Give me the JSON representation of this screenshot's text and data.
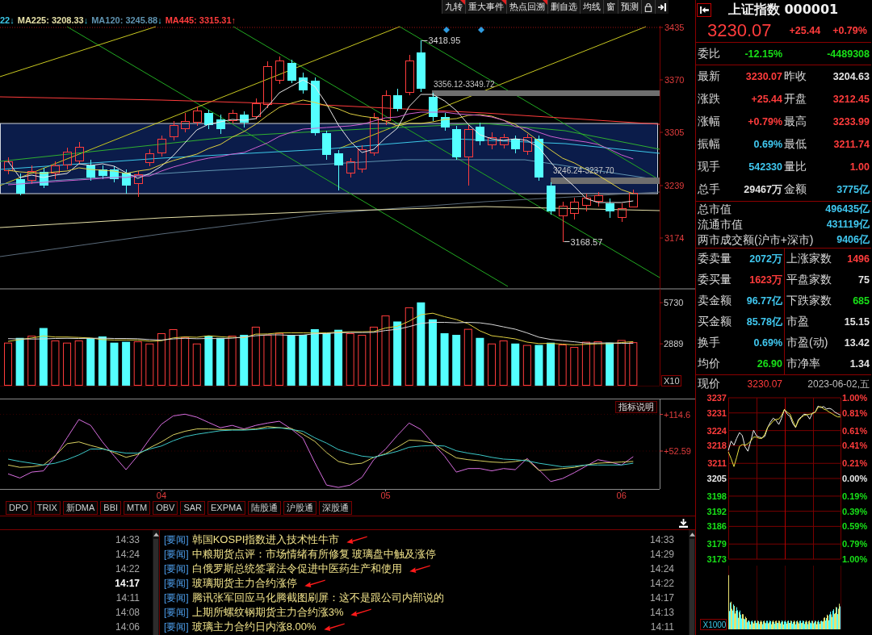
{
  "toolbar": {
    "buttons": [
      {
        "label": "九转",
        "flagged": true
      },
      {
        "label": "重大事件",
        "flagged": true
      },
      {
        "label": "热点回溯",
        "flagged": true
      },
      {
        "label": "删自选",
        "flagged": false
      },
      {
        "label": "均线",
        "flagged": false
      },
      {
        "label": "窗",
        "flagged": false
      },
      {
        "label": "预测",
        "flagged": false
      }
    ]
  },
  "ma_legend": [
    {
      "label": "22",
      "arrow": "↓",
      "rising": false,
      "color": "#3cc8e8"
    },
    {
      "label": "MA225: 3208.33",
      "arrow": "↓",
      "rising": false,
      "color": "#e6e0a8"
    },
    {
      "label": "MA120: 3245.88",
      "arrow": "↓",
      "rising": false,
      "color": "#5f93b0"
    },
    {
      "label": "MA445: 3315.31",
      "arrow": "↑",
      "rising": true,
      "color": "#ff3c3c"
    }
  ],
  "price_chart": {
    "annotations": [
      {
        "kind": "high",
        "text": "3418.95"
      },
      {
        "kind": "gap",
        "text": "3356.12-3349.72"
      },
      {
        "kind": "gap",
        "text": "3246.24-3237.70"
      },
      {
        "kind": "low",
        "text": "3168.57"
      }
    ],
    "chart_data": {
      "type": "candlestick",
      "categories": [
        null,
        null,
        null,
        null,
        null,
        null,
        null,
        null,
        null,
        null,
        null,
        null,
        null,
        null,
        null,
        null,
        null,
        null,
        null,
        null,
        null,
        null,
        null,
        null,
        null,
        null,
        null,
        null,
        null,
        null,
        null,
        null,
        null,
        null,
        null,
        null,
        null,
        null,
        null,
        null,
        null,
        null,
        null,
        null,
        null,
        null,
        null,
        null,
        null,
        null,
        null,
        null,
        null,
        null
      ],
      "ylim": [
        3111,
        3437
      ],
      "yticks": [
        3435,
        3370,
        3305,
        3239,
        3174
      ],
      "ohlc": [
        [
          3257,
          3274,
          3253,
          3269
        ],
        [
          3247,
          3254,
          3227,
          3229
        ],
        [
          3245,
          3264,
          3241,
          3257
        ],
        [
          3256,
          3261,
          3236,
          3239
        ],
        [
          3254,
          3269,
          3247,
          3264
        ],
        [
          3264,
          3286,
          3259,
          3281
        ],
        [
          3269,
          3293,
          3266,
          3287
        ],
        [
          3264,
          3271,
          3245,
          3249
        ],
        [
          3259,
          3264,
          3247,
          3251
        ],
        [
          3259,
          3263,
          3243,
          3247
        ],
        [
          3255,
          3259,
          3229,
          3239
        ],
        [
          3241,
          3257,
          3225,
          3253
        ],
        [
          3267,
          3284,
          3263,
          3279
        ],
        [
          3279,
          3301,
          3275,
          3297
        ],
        [
          3299,
          3319,
          3295,
          3314
        ],
        [
          3309,
          3329,
          3305,
          3319
        ],
        [
          3317,
          3337,
          3313,
          3332
        ],
        [
          3329,
          3333,
          3309,
          3314
        ],
        [
          3321,
          3327,
          3303,
          3309
        ],
        [
          3319,
          3333,
          3316,
          3329
        ],
        [
          3327,
          3331,
          3311,
          3317
        ],
        [
          3324,
          3347,
          3321,
          3341
        ],
        [
          3339,
          3393,
          3335,
          3387
        ],
        [
          3369,
          3399,
          3365,
          3394
        ],
        [
          3391,
          3395,
          3366,
          3369
        ],
        [
          3373,
          3379,
          3353,
          3357
        ],
        [
          3369,
          3373,
          3301,
          3304
        ],
        [
          3304,
          3307,
          3271,
          3277
        ],
        [
          3279,
          3283,
          3233,
          3264
        ],
        [
          3254,
          3273,
          3249,
          3269
        ],
        [
          3259,
          3289,
          3255,
          3284
        ],
        [
          3279,
          3329,
          3276,
          3324
        ],
        [
          3319,
          3357,
          3314,
          3351
        ],
        [
          3351,
          3359,
          3331,
          3334
        ],
        [
          3354,
          3401,
          3351,
          3394
        ],
        [
          3404,
          3419,
          3355,
          3359
        ],
        [
          3349,
          3354,
          3319,
          3324
        ],
        [
          3324,
          3329,
          3307,
          3311
        ],
        [
          3309,
          3313,
          3271,
          3274
        ],
        [
          3274,
          3314,
          3239,
          3309
        ],
        [
          3312,
          3317,
          3289,
          3294
        ],
        [
          3289,
          3305,
          3284,
          3299
        ],
        [
          3289,
          3303,
          3285,
          3299
        ],
        [
          3297,
          3301,
          3279,
          3284
        ],
        [
          3281,
          3303,
          3277,
          3299
        ],
        [
          3297,
          3301,
          3245,
          3249
        ],
        [
          3239,
          3243,
          3203,
          3207
        ],
        [
          3201,
          3219,
          3169,
          3214
        ],
        [
          3204,
          3224,
          3197,
          3219
        ],
        [
          3214,
          3229,
          3207,
          3224
        ],
        [
          3219,
          3231,
          3213,
          3227
        ],
        [
          3217,
          3223,
          3199,
          3207
        ],
        [
          3199,
          3217,
          3194,
          3211
        ],
        [
          3212,
          3234,
          3212,
          3230
        ]
      ],
      "series": [
        {
          "type": "line",
          "color": "#e8e8e8",
          "values": [
            3269,
            3249,
            3252,
            3249,
            3252,
            3254,
            3266,
            3264,
            3266,
            3263,
            3255,
            3248,
            3254,
            3263,
            3276,
            3292,
            3308,
            3315,
            3318,
            3321,
            3320,
            3322,
            3337,
            3354,
            3362,
            3370,
            3362,
            3340,
            3314,
            3294,
            3280,
            3284,
            3298,
            3310,
            3337,
            3352,
            3352,
            3344,
            3332,
            3315,
            3302,
            3297,
            3295,
            3297,
            3295,
            3286,
            3268,
            3251,
            3238,
            3223,
            3218,
            3218,
            3218,
            3220
          ]
        },
        {
          "type": "line",
          "color": "#e0d040",
          "values": [
            3258,
            3256,
            3255,
            3254,
            3256,
            3257,
            3261,
            3259,
            3258,
            3257,
            3254,
            3257,
            3259,
            3265,
            3270,
            3274,
            3278,
            3285,
            3290,
            3299,
            3306,
            3315,
            3326,
            3336,
            3341,
            3345,
            3342,
            3338,
            3334,
            3328,
            3325,
            3323,
            3319,
            3313,
            3316,
            3316,
            3318,
            3321,
            3322,
            3326,
            3327,
            3325,
            3320,
            3315,
            3305,
            3294,
            3283,
            3273,
            3267,
            3259,
            3252,
            3243,
            3234,
            3229
          ]
        },
        {
          "type": "line",
          "color": "#d060d0",
          "values": [
            3240,
            3241,
            3242,
            3243,
            3244,
            3245,
            3246,
            3247,
            3248,
            3249,
            3249,
            3251,
            3251,
            3257,
            3262,
            3266,
            3270,
            3273,
            3275,
            3278,
            3280,
            3286,
            3292,
            3300,
            3305,
            3309,
            3310,
            3311,
            3312,
            3313,
            3315,
            3319,
            3323,
            3324,
            3328,
            3330,
            3330,
            3330,
            3328,
            3327,
            3326,
            3324,
            3320,
            3312,
            3310,
            3305,
            3300,
            3297,
            3295,
            3293,
            3290,
            3284,
            3277,
            3272
          ]
        }
      ]
    }
  },
  "volume_chart": {
    "scale_label": "X10",
    "chart_data": {
      "type": "bar",
      "stacked": true,
      "ylim": [
        0,
        6684
      ],
      "yticks": [
        2889,
        5730
      ],
      "series": [
        {
          "type": "bar",
          "color": "#ff3c3c",
          "values": [
            2970,
            null,
            3450,
            null,
            3120,
            2970,
            3120,
            null,
            null,
            null,
            null,
            3060,
            2910,
            3620,
            3900,
            3360,
            2910,
            null,
            null,
            3450,
            null,
            4070,
            3510,
            3640,
            null,
            null,
            null,
            null,
            null,
            3620,
            3510,
            4070,
            4850,
            null,
            5410,
            null,
            null,
            null,
            null,
            3920,
            null,
            2910,
            3120,
            null,
            2810,
            null,
            null,
            2840,
            2670,
            3030,
            3060,
            null,
            3150,
            3000
          ]
        },
        {
          "type": "bar",
          "color": "#54ffff",
          "values": [
            null,
            3300,
            null,
            3980,
            null,
            null,
            null,
            3280,
            3400,
            2970,
            3030,
            null,
            null,
            null,
            null,
            null,
            null,
            3450,
            3300,
            null,
            3510,
            null,
            null,
            null,
            3510,
            3510,
            3900,
            3640,
            3860,
            null,
            null,
            null,
            null,
            4430,
            null,
            5750,
            4580,
            3620,
            3510,
            null,
            3300,
            null,
            null,
            2910,
            null,
            2810,
            2970,
            null,
            null,
            null,
            null,
            2970,
            null,
            null
          ]
        },
        {
          "type": "line",
          "color": "#e0d040",
          "values": [
            3060,
            3180,
            3290,
            3430,
            3360,
            3360,
            3330,
            3290,
            3180,
            3150,
            3160,
            3150,
            3070,
            3100,
            3300,
            3370,
            3340,
            3450,
            3380,
            3330,
            3310,
            3560,
            3570,
            3640,
            3650,
            3650,
            3630,
            3650,
            3700,
            3720,
            3720,
            3740,
            3980,
            4100,
            4450,
            4900,
            5000,
            4760,
            4570,
            4280,
            3790,
            3450,
            3350,
            3230,
            3010,
            2910,
            2920,
            2870,
            2820,
            2860,
            2890,
            2900,
            2980,
            3040
          ]
        },
        {
          "type": "line",
          "color": "#d8d8d8",
          "values": [
            3250,
            3230,
            3220,
            3230,
            3260,
            3270,
            3260,
            3270,
            3280,
            3260,
            3260,
            3240,
            3180,
            3150,
            3230,
            3270,
            3240,
            3260,
            3250,
            3280,
            3360,
            3450,
            3510,
            3510,
            3470,
            3490,
            3580,
            3600,
            3650,
            3670,
            3670,
            3680,
            3810,
            3890,
            4080,
            4300,
            4370,
            4370,
            4340,
            4370,
            4340,
            4230,
            4060,
            3900,
            3640,
            3350,
            3190,
            3110,
            3030,
            2940,
            2940,
            2950,
            2920,
            2930
          ]
        }
      ]
    }
  },
  "indicator_chart": {
    "help_button": "指标说明",
    "chart_data": {
      "type": "line",
      "grid": true,
      "ylim": [
        -11.6,
        140
      ],
      "yticks": [
        {
          "value": 114.6,
          "label": "+114.6"
        },
        {
          "value": 52.59,
          "label": "+52.59"
        }
      ],
      "categories": [
        null,
        null,
        null,
        null,
        null,
        null,
        null,
        null,
        null,
        null,
        null,
        null,
        null,
        "04",
        null,
        null,
        null,
        null,
        null,
        null,
        null,
        null,
        null,
        null,
        null,
        null,
        null,
        null,
        null,
        null,
        null,
        null,
        "05",
        null,
        null,
        null,
        null,
        null,
        null,
        null,
        null,
        null,
        null,
        null,
        null,
        null,
        null,
        null,
        null,
        null,
        null,
        null,
        "06",
        null
      ],
      "series": [
        {
          "color": "#d86ee0",
          "values": [
            14,
            7,
            17,
            19,
            44,
            75,
            106,
            96,
            68,
            44,
            21,
            45,
            73,
            98,
            112,
            115,
            110,
            101,
            92,
            96,
            90,
            96,
            100,
            103,
            90,
            74,
            33,
            -5,
            -9,
            -5,
            8,
            38,
            56,
            79,
            100,
            89,
            66,
            44,
            17,
            23,
            23,
            19,
            23,
            21,
            40,
            21,
            1,
            6,
            16,
            27,
            38,
            34,
            29,
            43
          ]
        },
        {
          "color": "#d8d060",
          "values": [
            29,
            25,
            26,
            29,
            45,
            65,
            68,
            62,
            57,
            50,
            42,
            47,
            58,
            68,
            80,
            86,
            90,
            90,
            89,
            89,
            89,
            90,
            94,
            92,
            91,
            81,
            69,
            50,
            35,
            30,
            32,
            42,
            48,
            59,
            71,
            70,
            66,
            53,
            41,
            38,
            36,
            34,
            33,
            35,
            38,
            20,
            21,
            23,
            25,
            29,
            32,
            33,
            34,
            35
          ]
        },
        {
          "color": "#3cc8c8",
          "values": [
            39,
            35,
            32,
            29,
            32,
            38,
            46,
            56,
            56,
            52,
            49,
            49,
            56,
            61,
            70,
            77,
            81,
            84,
            87,
            88,
            88,
            89,
            91,
            92,
            89,
            86,
            75,
            66,
            55,
            49,
            44,
            42,
            47,
            52,
            59,
            61,
            62,
            61,
            53,
            49,
            46,
            42,
            39,
            38,
            36,
            32,
            29,
            26,
            27,
            29,
            29,
            29,
            29,
            32
          ]
        }
      ]
    }
  },
  "indicator_tabs": [
    {
      "label": "DPO",
      "selected": false
    },
    {
      "label": "TRIX",
      "selected": false
    },
    {
      "label": "新DMA",
      "selected": false
    },
    {
      "label": "BBI",
      "selected": false
    },
    {
      "label": "MTM",
      "selected": false
    },
    {
      "label": "OBV",
      "selected": false
    },
    {
      "label": "SAR",
      "selected": false
    },
    {
      "label": "EXPMA",
      "selected": false
    },
    {
      "label": "陆股通",
      "selected": false
    },
    {
      "label": "沪股通",
      "selected": false
    },
    {
      "label": "深股通",
      "selected": false
    }
  ],
  "news": {
    "left_times": [
      {
        "time": "14:33",
        "selected": false
      },
      {
        "time": "14:24",
        "selected": false
      },
      {
        "time": "14:22",
        "selected": false
      },
      {
        "time": "14:17",
        "selected": true
      },
      {
        "time": "14:11",
        "selected": false
      },
      {
        "time": "14:08",
        "selected": false
      },
      {
        "time": "14:06",
        "selected": false
      }
    ],
    "items": [
      {
        "tag": "[要闻]",
        "title": "韩国KOSPI指数进入技术性牛市",
        "time": "14:33",
        "marked": true
      },
      {
        "tag": "[要闻]",
        "title": "中粮期货点评：市场情绪有所修复 玻璃盘中触及涨停",
        "time": "14:29",
        "marked": false
      },
      {
        "tag": "[要闻]",
        "title": "白俄罗斯总统签署法令促进中医药生产和使用",
        "time": "14:24",
        "marked": true
      },
      {
        "tag": "[要闻]",
        "title": "玻璃期货主力合约涨停",
        "time": "14:22",
        "marked": true
      },
      {
        "tag": "[要闻]",
        "title": "腾讯张军回应马化腾截图刷屏：这不是跟公司内部说的",
        "time": "14:17",
        "marked": false
      },
      {
        "tag": "[要闻]",
        "title": "上期所螺纹钢期货主力合约涨3%",
        "time": "14:13",
        "marked": true
      },
      {
        "tag": "[要闻]",
        "title": "玻璃主力合约日内涨8.00%",
        "time": "14:11",
        "marked": true
      }
    ]
  },
  "quote": {
    "title": "上证指数 000001",
    "price": "3230.07",
    "change": "+25.44",
    "change_pct": "+0.79%",
    "color": "#ff3c3c"
  },
  "order_ratio": {
    "label": "委比",
    "pct": "-12.15%",
    "diff": "-4489308",
    "color": "#18e018"
  },
  "stats": [
    [
      {
        "label": "最新",
        "value": "3230.07",
        "color": "#ff3c3c"
      },
      {
        "label": "昨收",
        "value": "3204.63",
        "color": "#e4e4e4"
      }
    ],
    [
      {
        "label": "涨跌",
        "value": "+25.44",
        "color": "#ff3c3c"
      },
      {
        "label": "开盘",
        "value": "3212.45",
        "color": "#ff3c3c"
      }
    ],
    [
      {
        "label": "涨幅",
        "value": "+0.79%",
        "color": "#ff3c3c"
      },
      {
        "label": "最高",
        "value": "3233.99",
        "color": "#ff3c3c"
      }
    ],
    [
      {
        "label": "振幅",
        "value": "0.69%",
        "color": "#40c8f0"
      },
      {
        "label": "最低",
        "value": "3211.74",
        "color": "#ff3c3c"
      }
    ],
    [
      {
        "label": "现手",
        "value": "542330",
        "color": "#40c8f0"
      },
      {
        "label": "量比",
        "value": "1.00",
        "color": "#ff3c3c"
      }
    ],
    [
      {
        "label": "总手",
        "value": "29467万",
        "color": "#e4e4e4"
      },
      {
        "label": "金额",
        "value": "3775亿",
        "color": "#40c8f0"
      }
    ]
  ],
  "market": [
    {
      "label": "总市值",
      "value": "496435亿",
      "color": "#40c8f0"
    },
    {
      "label": "流通市值",
      "value": "431119亿",
      "color": "#40c8f0"
    },
    {
      "label": "两市成交额(沪市+深市)",
      "value": "9406亿",
      "color": "#40c8f0"
    }
  ],
  "book": [
    [
      {
        "label": "委卖量",
        "value": "2072万",
        "color": "#40c8f0"
      },
      {
        "label": "上涨家数",
        "value": "1496",
        "color": "#ff3c3c"
      }
    ],
    [
      {
        "label": "委买量",
        "value": "1623万",
        "color": "#ff3c3c"
      },
      {
        "label": "平盘家数",
        "value": "75",
        "color": "#e4e4e4"
      }
    ],
    [
      {
        "label": "卖金额",
        "value": "96.77亿",
        "color": "#40c8f0"
      },
      {
        "label": "下跌家数",
        "value": "685",
        "color": "#18e018"
      }
    ],
    [
      {
        "label": "买金额",
        "value": "85.78亿",
        "color": "#40c8f0"
      },
      {
        "label": "市盈",
        "value": "15.15",
        "color": "#e4e4e4"
      }
    ],
    [
      {
        "label": "换手",
        "value": "0.69%",
        "color": "#40c8f0"
      },
      {
        "label": "市盈(动)",
        "value": "13.42",
        "color": "#e4e4e4"
      }
    ],
    [
      {
        "label": "均价",
        "value": "26.90",
        "color": "#18e018"
      },
      {
        "label": "市净率",
        "value": "1.34",
        "color": "#e4e4e4"
      }
    ]
  ],
  "intraday": {
    "label": "现价",
    "current": {
      "value": "3230.07",
      "color": "#ff3c3c"
    },
    "date": "2023-06-02,五",
    "volume_scale": "X1000",
    "percent_labels": [
      {
        "label": "1.00%",
        "color": "#ff3c3c"
      },
      {
        "label": "0.81%",
        "color": "#ff3c3c"
      },
      {
        "label": "0.61%",
        "color": "#ff3c3c"
      },
      {
        "label": "0.41%",
        "color": "#ff3c3c"
      },
      {
        "label": "0.21%",
        "color": "#ff3c3c"
      },
      {
        "label": "0.00%",
        "color": "#e8e8e8"
      },
      {
        "label": "0.19%",
        "color": "#18e018"
      },
      {
        "label": "0.39%",
        "color": "#18e018"
      },
      {
        "label": "0.59%",
        "color": "#18e018"
      },
      {
        "label": "0.79%",
        "color": "#18e018"
      },
      {
        "label": "1.00%",
        "color": "#18e018"
      }
    ],
    "chart_data": {
      "type": "line",
      "grid": true,
      "categories": [
        null,
        null,
        null,
        null,
        null,
        null,
        null,
        null,
        null,
        null,
        null,
        null,
        null,
        null,
        null,
        null,
        null,
        null,
        null,
        null,
        null,
        null,
        null,
        null,
        null,
        null,
        null,
        null,
        null,
        null,
        null,
        null,
        null,
        null,
        null,
        null,
        null,
        null,
        null,
        null,
        null
      ],
      "ylim": [
        3173,
        3237
      ],
      "yticks": [
        3237,
        3231,
        3224,
        3218,
        3211,
        3205,
        3198,
        3192,
        3186,
        3179,
        3173
      ],
      "series": [
        {
          "color": "#f0f0f0",
          "values": [
            3216.1,
            3219.8,
            3218.2,
            3220.9,
            3223.2,
            3222.0,
            3217.5,
            3215.8,
            3219.8,
            3224.1,
            3222.0,
            3221.4,
            3221.1,
            3221.7,
            3225.2,
            3227.3,
            3228.9,
            3228.1,
            3226.4,
            3228.9,
            3232.4,
            3230.5,
            3229.6,
            3226.8,
            3225.2,
            3228.4,
            3229.4,
            3230.5,
            3230.3,
            3228.6,
            3231.0,
            3231.3,
            3233.7,
            3233.1,
            3233.5,
            3232.6,
            3232.8,
            3232.4,
            3231.3,
            3230.7,
            3230.1
          ]
        },
        {
          "color": "#e8e040",
          "values": [
            3215.6,
            3212.9,
            3209.7,
            3213.4,
            3217.7,
            3218.5,
            3218.2,
            3218.8,
            3219.8,
            3221.4,
            3221.4,
            3220.9,
            3220.9,
            3222.5,
            3225.2,
            3226.4,
            3227.8,
            3228.4,
            3228.6,
            3230.0,
            3232.4,
            3231.3,
            3230.5,
            3227.8,
            3225.4,
            3227.8,
            3229.2,
            3230.0,
            3230.3,
            3230.5,
            3230.7,
            3231.3,
            3233.2,
            3233.5,
            3232.6,
            3232.1,
            3231.3,
            3230.7,
            3230.0,
            3229.4,
            3229.4
          ]
        }
      ]
    }
  }
}
